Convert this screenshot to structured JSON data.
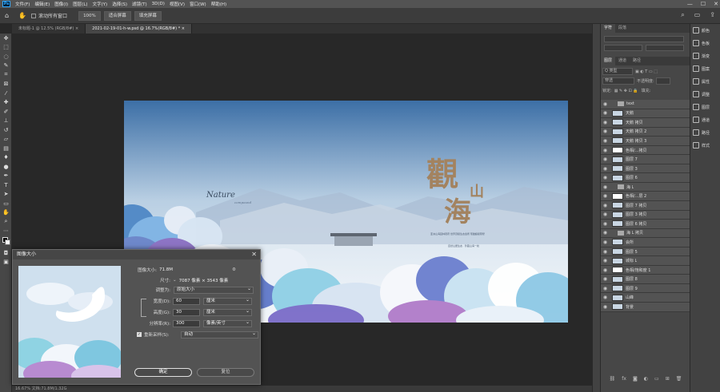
{
  "menubar": {
    "logo": "Ps",
    "items": [
      "文件(F)",
      "编辑(E)",
      "图像(I)",
      "图层(L)",
      "文字(Y)",
      "选择(S)",
      "滤镜(T)",
      "3D(D)",
      "视图(V)",
      "窗口(W)",
      "帮助(H)"
    ],
    "controls": [
      "—",
      "☐",
      "✕"
    ]
  },
  "options": {
    "scroll_all_label": "滚动所有窗口",
    "zoom_100": "100%",
    "fit_screen": "适合屏幕",
    "fill_screen": "填充屏幕"
  },
  "tabs": [
    {
      "label": "未标题-1 @ 12.5% (RGB/8#) ×"
    },
    {
      "label": "2021-02-19-01-h-w.psd @ 16.7%(RGB/8#) * ×"
    }
  ],
  "image": {
    "title_big": "觀",
    "title_small_1": "山",
    "title_big_2": "海",
    "nature_text": "Nature",
    "compound_text": "compound",
    "tagline": "亚洲山海园林观府 世界顶级生态会所 现磁超级墓墅",
    "subline": "自然山居生态 · 珍藏山海一线"
  },
  "dialog": {
    "title": "图像大小",
    "close": "✕",
    "image_size_label": "图像大小:",
    "image_size_value": "71.8M",
    "dimensions_label": "尺寸:",
    "dimensions_value": "7087 像素 × 3543 像素",
    "fit_label": "调整为:",
    "fit_value": "原始大小",
    "width_label": "宽度(D):",
    "width_value": "60",
    "width_unit": "厘米",
    "height_label": "高度(G):",
    "height_value": "30",
    "height_unit": "厘米",
    "res_label": "分辨率(R):",
    "res_value": "300",
    "res_unit": "像素/英寸",
    "resample_label": "重新采样(S):",
    "resample_value": "自动",
    "ok": "确定",
    "reset": "复位"
  },
  "panels": {
    "char_tabs": [
      "字符",
      "段落"
    ],
    "layer_tabs": [
      "图层",
      "通道",
      "路径"
    ],
    "filter_label": "Q 类型",
    "blend_mode": "穿透",
    "opacity_label": "不透明度:",
    "lock_label": "锁定:",
    "fill_label": "填充:"
  },
  "layers": [
    {
      "name": "text",
      "kind": "folder"
    },
    {
      "name": "天鹅",
      "kind": "layer"
    },
    {
      "name": "天鹅 拷贝",
      "kind": "layer"
    },
    {
      "name": "天鹅 拷贝 2",
      "kind": "layer"
    },
    {
      "name": "天鹅 拷贝 3",
      "kind": "layer"
    },
    {
      "name": "色相/...拷贝",
      "kind": "adj"
    },
    {
      "name": "图层 7",
      "kind": "layer"
    },
    {
      "name": "图层 3",
      "kind": "layer"
    },
    {
      "name": "图层 6",
      "kind": "layer"
    },
    {
      "name": "海 L",
      "kind": "folder"
    },
    {
      "name": "色相/...层 2",
      "kind": "adj"
    },
    {
      "name": "图层 7 拷贝",
      "kind": "layer"
    },
    {
      "name": "图层 3 拷贝",
      "kind": "layer"
    },
    {
      "name": "图层 6 拷贝",
      "kind": "layer"
    },
    {
      "name": "海 L 拷贝",
      "kind": "folder"
    },
    {
      "name": "会所",
      "kind": "layer"
    },
    {
      "name": "图层 5",
      "kind": "layer"
    },
    {
      "name": "城标 L",
      "kind": "layer"
    },
    {
      "name": "色相/饱和度 1",
      "kind": "adj"
    },
    {
      "name": "图层 8",
      "kind": "layer"
    },
    {
      "name": "图层 9",
      "kind": "layer"
    },
    {
      "name": "山峰",
      "kind": "layer"
    },
    {
      "name": "背景",
      "kind": "layer"
    }
  ],
  "dock": [
    {
      "label": "颜色",
      "icon": "color-icon"
    },
    {
      "label": "色板",
      "icon": "swatches-icon"
    },
    {
      "label": "渐变",
      "icon": "gradient-icon"
    },
    {
      "label": "图案",
      "icon": "patterns-icon"
    },
    {
      "label": "属性",
      "icon": "properties-icon"
    },
    {
      "label": "调整",
      "icon": "adjustments-icon"
    },
    {
      "label": "图层",
      "icon": "layers-icon"
    },
    {
      "label": "通道",
      "icon": "channels-icon"
    },
    {
      "label": "路径",
      "icon": "paths-icon"
    },
    {
      "label": "样式",
      "icon": "styles-icon"
    }
  ],
  "status": "16.67%  文档:71.8M/1.32G"
}
